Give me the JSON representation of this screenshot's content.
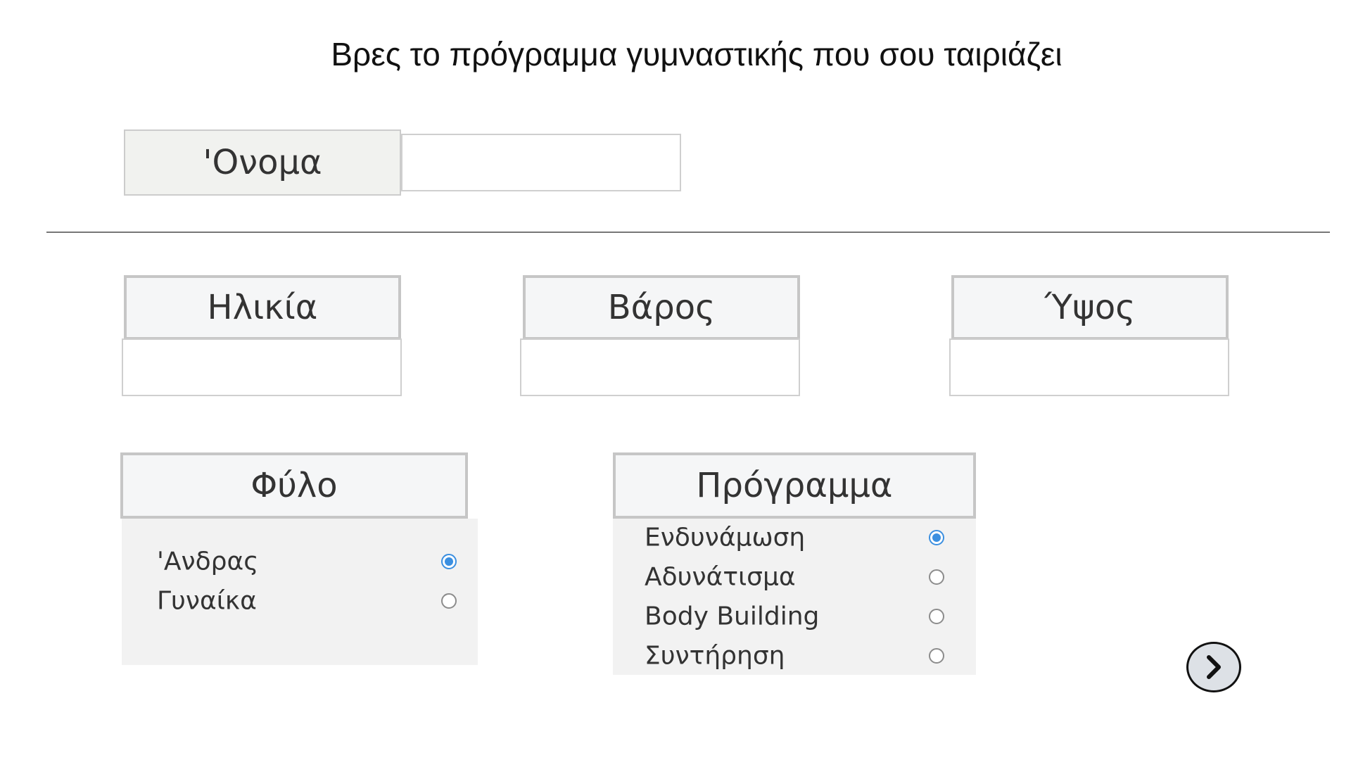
{
  "title": "Βρες το πρόγραμμα γυμναστικής που σου ταιριάζει",
  "name_field": {
    "label": "'Ονομα",
    "value": ""
  },
  "age_field": {
    "label": "Ηλικία",
    "value": ""
  },
  "weight_field": {
    "label": "Βάρος",
    "value": ""
  },
  "height_field": {
    "label": "Ύψος",
    "value": ""
  },
  "gender": {
    "label": "Φύλο",
    "options": [
      {
        "label": "'Ανδρας",
        "checked": true
      },
      {
        "label": "Γυναίκα",
        "checked": false
      }
    ]
  },
  "program": {
    "label": "Πρόγραμμα",
    "options": [
      {
        "label": "Ενδυνάμωση",
        "checked": true
      },
      {
        "label": "Αδυνάτισμα",
        "checked": false
      },
      {
        "label": "Body Building",
        "checked": false
      },
      {
        "label": "Συντήρηση",
        "checked": false
      }
    ]
  },
  "next_button": {
    "icon": "chevron-right-icon"
  },
  "colors": {
    "accent": "#3b8fe0",
    "label_background": "#f5f6f7",
    "panel_background": "#f2f2f2",
    "button_background": "#dde1e6"
  }
}
